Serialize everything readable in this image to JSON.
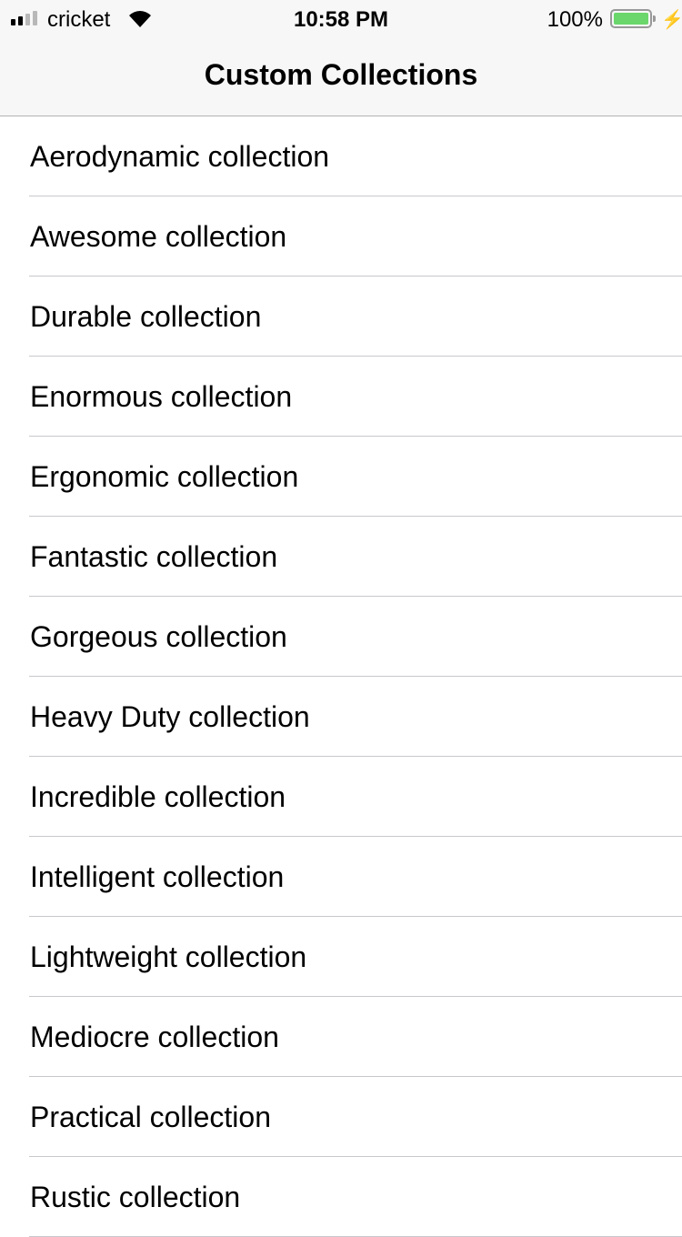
{
  "status_bar": {
    "carrier": "cricket",
    "time": "10:58 PM",
    "battery_percent": "100%",
    "battery_level": 1.0,
    "signal_bars": 2
  },
  "nav": {
    "title": "Custom Collections"
  },
  "collections": [
    "Aerodynamic collection",
    "Awesome collection",
    "Durable collection",
    "Enormous collection",
    "Ergonomic collection",
    "Fantastic collection",
    "Gorgeous collection",
    "Heavy Duty collection",
    "Incredible collection",
    "Intelligent collection",
    "Lightweight collection",
    "Mediocre collection",
    "Practical collection",
    "Rustic collection"
  ]
}
